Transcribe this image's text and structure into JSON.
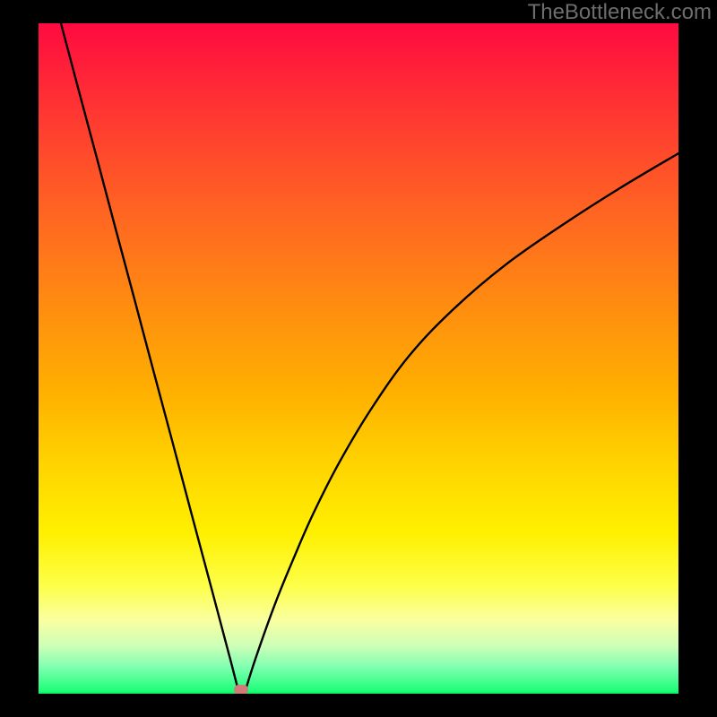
{
  "watermark": "TheBottleneck.com",
  "colors": {
    "frame_bg": "#000000",
    "gradient_top": "#ff0a40",
    "gradient_bottom": "#0deb5f",
    "curve_stroke": "#000000",
    "marker_fill": "#d27b7b"
  },
  "chart_data": {
    "type": "line",
    "title": "",
    "xlabel": "",
    "ylabel": "",
    "xlim": [
      0,
      100
    ],
    "ylim": [
      0,
      100
    ],
    "notes": "Background is a vertical heat-map gradient from red (top, high bottleneck) through orange/yellow to green (bottom, 0 %). The black V-shaped curve shows a bottleneck metric that descends steeply to ~0 near x≈31, then rises with diminishing slope toward ~80.6 at the right edge. A small rounded marker sits at the curve minimum.",
    "series": [
      {
        "name": "bottleneck_curve",
        "x": [
          3.5,
          6,
          9,
          12,
          15,
          18,
          21,
          24,
          27,
          30,
          31,
          32.2,
          34,
          37,
          40,
          43,
          47,
          52,
          58,
          65,
          73,
          82,
          91,
          100
        ],
        "y": [
          100,
          91,
          80.3,
          69.5,
          58.8,
          48,
          37.3,
          26.5,
          15.8,
          5,
          1.3,
          0.1,
          5.5,
          13.5,
          20.5,
          27,
          34.5,
          42.5,
          50.5,
          57.5,
          64,
          70,
          75.5,
          80.6
        ]
      }
    ],
    "marker": {
      "x": 31.6,
      "y": 0.6
    }
  }
}
